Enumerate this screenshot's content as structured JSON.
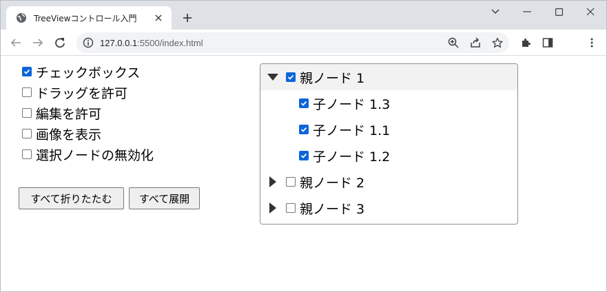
{
  "browser": {
    "tab_title": "TreeViewコントロール入門",
    "url_host": "127.0.0.1",
    "url_rest": ":5500/index.html"
  },
  "options": [
    {
      "label": "チェックボックス",
      "checked": true
    },
    {
      "label": "ドラッグを許可",
      "checked": false
    },
    {
      "label": "編集を許可",
      "checked": false
    },
    {
      "label": "画像を表示",
      "checked": false
    },
    {
      "label": "選択ノードの無効化",
      "checked": false
    }
  ],
  "buttons": {
    "collapse_all": "すべて折りたたむ",
    "expand_all": "すべて展開"
  },
  "tree": [
    {
      "label": "親ノード 1",
      "checked": true,
      "expanded": true,
      "level": 0
    },
    {
      "label": "子ノード 1.3",
      "checked": true,
      "level": 1
    },
    {
      "label": "子ノード 1.1",
      "checked": true,
      "level": 1
    },
    {
      "label": "子ノード 1.2",
      "checked": true,
      "level": 1
    },
    {
      "label": "親ノード 2",
      "checked": false,
      "expanded": false,
      "level": 0
    },
    {
      "label": "親ノード 3",
      "checked": false,
      "expanded": false,
      "level": 0
    }
  ],
  "colors": {
    "accent": "#0b65d8",
    "tabstrip": "#dee1e6",
    "omnibox": "#f1f3f4",
    "selected_row": "#f2f2f2"
  }
}
